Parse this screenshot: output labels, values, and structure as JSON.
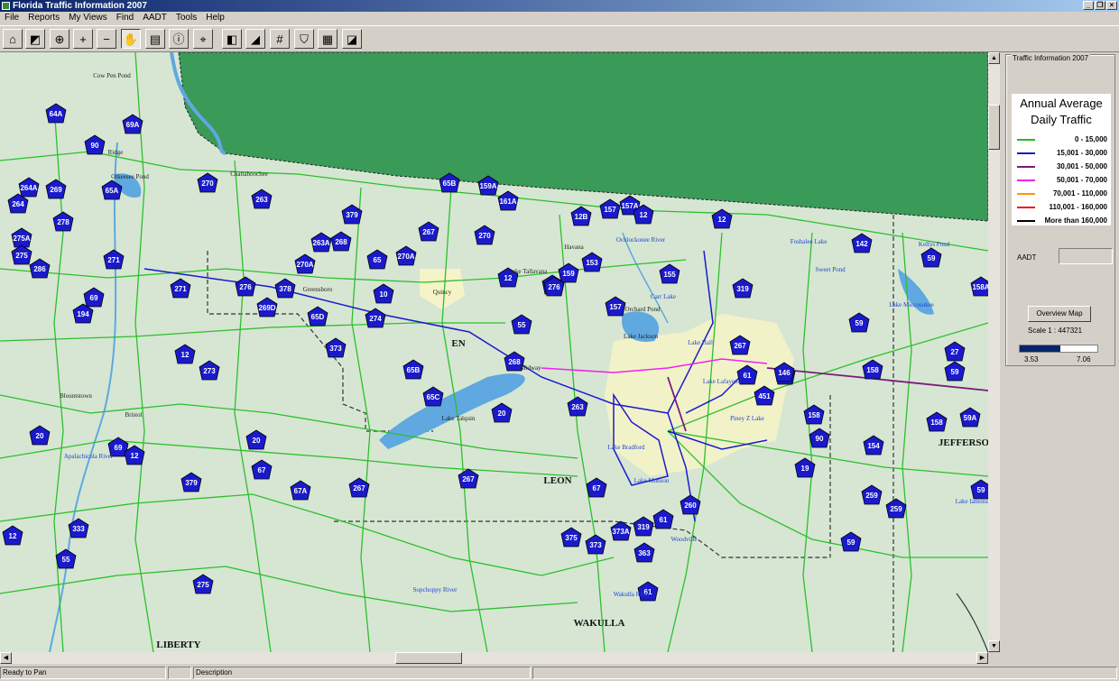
{
  "window": {
    "title": "Florida Traffic Information 2007"
  },
  "menu": [
    "File",
    "Reports",
    "My Views",
    "Find",
    "AADT",
    "Tools",
    "Help"
  ],
  "panel": {
    "group_title": "Traffic Information 2007",
    "legend_title_1": "Annual Average",
    "legend_title_2": "Daily Traffic",
    "legend": [
      {
        "label": "0 - 15,000",
        "color": "#22bb22"
      },
      {
        "label": "15,001 - 30,000",
        "color": "#1a1acc"
      },
      {
        "label": "30,001 - 50,000",
        "color": "#7a1a7a"
      },
      {
        "label": "50,001 - 70,000",
        "color": "#ee22ee"
      },
      {
        "label": "70,001 - 110,000",
        "color": "#ff9900"
      },
      {
        "label": "110,001 - 160,000",
        "color": "#ee1111"
      },
      {
        "label": "More than 160,000",
        "color": "#000000"
      }
    ],
    "aadt_label": "AADT",
    "overview_button": "Overview Map",
    "scale_text": "Scale 1 :    447321",
    "scale_min": "3.53",
    "scale_max": "7.06"
  },
  "status": {
    "left": "Ready to Pan",
    "desc": "Description"
  },
  "map": {
    "counties": [
      "LEON",
      "WAKULLA",
      "LIBERTY",
      "JEFFERSO",
      "EN"
    ],
    "towns": [
      "Cow Pen Pond",
      "Ridge",
      "Chattahoochee",
      "Otkeesee Pond",
      "Quincy",
      "Greensboro",
      "Havana",
      "Lake Tallavana",
      "Midway",
      "Lake Talquin",
      "Bristol",
      "Blountstown",
      "Lake Jackson",
      "Orchard Pond",
      "Carr Lake",
      "Lake Hall",
      "Lake Lafayette",
      "Piney Z Lake",
      "Lake Bradford",
      "Lake Munson",
      "Woodville",
      "Foshalee Lake",
      "Sweet Pond",
      "Lake Miccosukee",
      "Kellys Pond",
      "Lake Iamonia",
      "Apalachicola River",
      "Ochlockonee River",
      "Sopchoppy River",
      "Wakulla River"
    ],
    "shields": [
      "64A",
      "69A",
      "90",
      "264A",
      "264",
      "278",
      "275A",
      "275",
      "286",
      "271",
      "269",
      "270",
      "65A",
      "69",
      "194",
      "271",
      "273",
      "12",
      "267",
      "276",
      "270A",
      "269D",
      "378",
      "65D",
      "274",
      "65",
      "373",
      "379",
      "263A",
      "268",
      "10",
      "270A",
      "55",
      "65B",
      "159A",
      "161A",
      "263",
      "270",
      "12B",
      "157",
      "157A",
      "12",
      "153",
      "12",
      "153",
      "159",
      "276",
      "12",
      "155",
      "157",
      "319",
      "90",
      "268",
      "65B",
      "65C",
      "20",
      "263",
      "20",
      "267",
      "20",
      "69",
      "12",
      "379",
      "67",
      "67A",
      "267",
      "67",
      "375",
      "373",
      "373A",
      "319",
      "61",
      "260",
      "363",
      "61",
      "267",
      "61",
      "451",
      "146",
      "158",
      "90",
      "158",
      "27",
      "59",
      "158A",
      "59A",
      "158",
      "59",
      "259",
      "19",
      "154",
      "259",
      "59",
      "59",
      "142",
      "59",
      "55",
      "333",
      "12",
      "275"
    ]
  }
}
